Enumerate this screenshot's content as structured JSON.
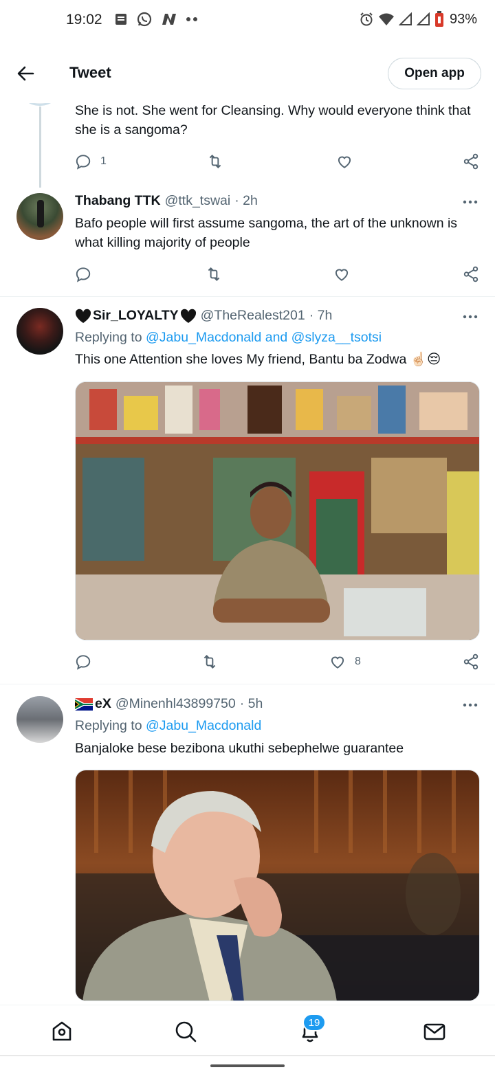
{
  "status_bar": {
    "time": "19:02",
    "battery": "93%",
    "left_icons": [
      "message-icon",
      "whatsapp-icon",
      "n-app-icon",
      "more-dots-icon"
    ],
    "right_icons": [
      "alarm-icon",
      "wifi-icon",
      "signal-icon",
      "signal-icon",
      "battery-icon"
    ]
  },
  "header": {
    "title": "Tweet",
    "open_app": "Open app"
  },
  "tweets": [
    {
      "text": "She is not. She went for Cleansing. Why would everyone think that she is a sangoma?",
      "reply_count": "1",
      "retweet_count": "",
      "like_count": ""
    },
    {
      "name": "Thabang TTK",
      "handle": "@ttk_tswai",
      "time": "· 2h",
      "text": "Bafo people will first assume sangoma, the art of the unknown is what killing majority of people",
      "reply_count": "",
      "like_count": ""
    },
    {
      "name": "Sir_LOYALTY",
      "handle": "@TheRealest201",
      "time": "· 7h",
      "replying_prefix": "Replying to",
      "replying_mentions": "@Jabu_Macdonald and @slyza__tsotsi",
      "text": "This one Attention she loves My friend, Bantu ba Zodwa ☝🏻😔",
      "reply_count": "",
      "like_count": "8"
    },
    {
      "name": "eX",
      "handle": "@Minenhl43899750",
      "time": "· 5h",
      "replying_prefix": "Replying to",
      "replying_mentions": "@Jabu_Macdonald",
      "text": "Banjaloke bese bezibona ukuthi sebephelwe guarantee"
    }
  ],
  "bottom_nav": {
    "items": [
      "home-icon",
      "search-icon",
      "notifications-icon",
      "messages-icon"
    ],
    "notification_badge": "19"
  },
  "colors": {
    "accent": "#1d9bf0",
    "text": "#0f1419",
    "secondary": "#536471"
  }
}
